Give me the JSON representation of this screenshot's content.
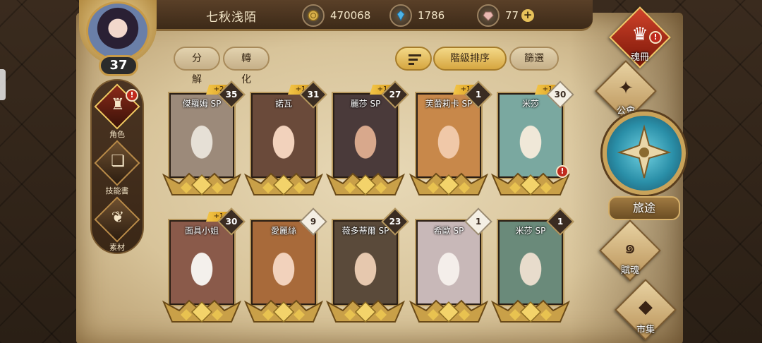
{
  "player": {
    "name": "七秋浅陌",
    "level": "37"
  },
  "currencies": [
    {
      "icon": "gold-coin-icon",
      "value": "470068",
      "color": "#d9b04a"
    },
    {
      "icon": "blue-crystal-icon",
      "value": "1786",
      "color": "#4fb4e6"
    },
    {
      "icon": "pink-gem-icon",
      "value": "77",
      "color": "#e8b8b0"
    }
  ],
  "toolbar": {
    "decompose": "分解",
    "convert": "轉化",
    "sort_label": "階級排序",
    "filter_label": "篩選"
  },
  "left_nav": [
    {
      "label": "角色",
      "icon": "helmet-icon",
      "alert": "!"
    },
    {
      "label": "技能書",
      "icon": "skill-book-icon"
    },
    {
      "label": "素材",
      "icon": "material-icon"
    }
  ],
  "right_nav": {
    "soul_book": {
      "label": "魂冊",
      "icon": "soul-helmet-icon",
      "alert": "!"
    },
    "guild": {
      "label": "公會",
      "icon": "guild-icon"
    },
    "journey": {
      "label": "旅途",
      "icon": "journey-emblem-icon"
    },
    "talent": {
      "label": "賦魂",
      "icon": "talent-swirl-icon"
    },
    "market": {
      "label": "市集",
      "icon": "gem-icon"
    }
  },
  "cards": [
    {
      "name": "傑羅姆 SP",
      "level": "35",
      "plus": "+2",
      "bg": "#9c8a7a",
      "accent": "#e6e0d6"
    },
    {
      "name": "諾瓦",
      "level": "31",
      "plus": "+1",
      "bg": "#6a4a3a",
      "accent": "#f2d2bc"
    },
    {
      "name": "麗莎 SP",
      "level": "27",
      "plus": "+1",
      "bg": "#4a3a3a",
      "accent": "#d8a88c"
    },
    {
      "name": "芙蕾莉卡 SP",
      "level": "1",
      "plus": "+1",
      "bg": "#c8884a",
      "accent": "#f0c8a8"
    },
    {
      "name": "米莎",
      "level": "30",
      "plus": "+1",
      "bg": "#7aa8a0",
      "accent": "#f0e8d8",
      "alert": "!"
    },
    {
      "name": "面具小姐",
      "level": "30",
      "plus": "+1",
      "bg": "#8a5a4a",
      "accent": "#f4f0ec"
    },
    {
      "name": "愛麗絲",
      "level": "9",
      "bg": "#a86a3a",
      "accent": "#f2d2bc"
    },
    {
      "name": "薇多蒂爾 SP",
      "level": "23",
      "bg": "#5a4a3a",
      "accent": "#e6c8ae"
    },
    {
      "name": "希歐 SP",
      "level": "1",
      "bg": "#c8b8b8",
      "accent": "#f4eeea"
    },
    {
      "name": "米莎 SP",
      "level": "1",
      "bg": "#6a8a7a",
      "accent": "#e8dccc"
    }
  ]
}
